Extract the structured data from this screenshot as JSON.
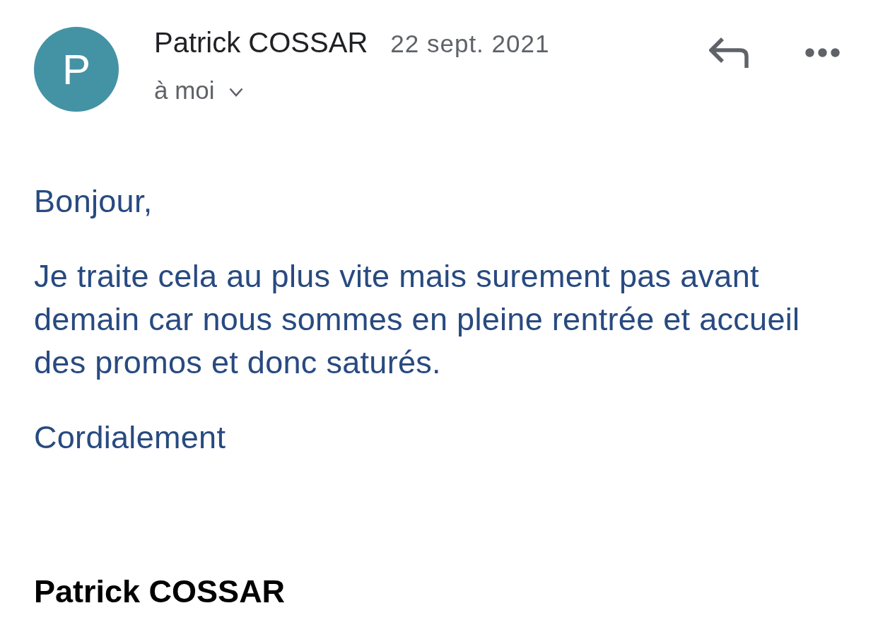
{
  "header": {
    "avatar_initial": "P",
    "sender": "Patrick COSSAR",
    "date": "22 sept. 2021",
    "recipient": "à moi"
  },
  "body": {
    "paragraphs": [
      "Bonjour,",
      "Je traite cela au plus vite mais surement pas avant demain car nous sommes en pleine rentrée et accueil des promos et donc saturés.",
      "Cordialement"
    ],
    "signature": "Patrick COSSAR"
  }
}
